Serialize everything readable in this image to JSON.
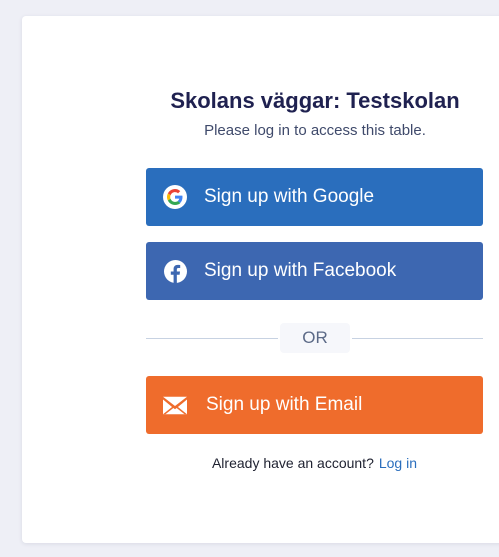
{
  "header": {
    "title": "Skolans väggar: Testskolan",
    "subtitle": "Please log in to access this table."
  },
  "buttons": {
    "google": {
      "label": "Sign up with Google",
      "icon": "google-icon"
    },
    "facebook": {
      "label": "Sign up with Facebook",
      "icon": "facebook-icon"
    },
    "email": {
      "label": "Sign up with Email",
      "icon": "envelope-icon"
    }
  },
  "divider": {
    "label": "OR"
  },
  "footer": {
    "prompt": "Already have an account?",
    "login_label": "Log in"
  },
  "colors": {
    "google": "#2a6ebd",
    "facebook": "#3d67b1",
    "email": "#ef6c2c",
    "title": "#1f2150",
    "link": "#2a6ebd"
  }
}
